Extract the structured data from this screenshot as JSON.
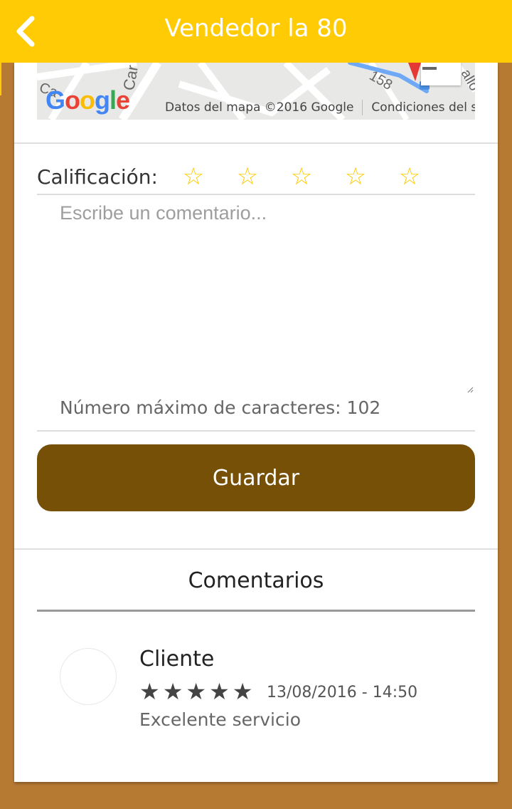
{
  "header": {
    "title": "Vendedor la 80"
  },
  "map": {
    "attribution": "Datos del mapa ©2016 Google",
    "terms": "Condiciones del servicio",
    "logo_letters": [
      "G",
      "o",
      "o",
      "g",
      "l",
      "e"
    ],
    "street_labels": [
      "Car",
      "158",
      "Ca",
      "allo"
    ]
  },
  "rating": {
    "label": "Calificación:",
    "stars": [
      "☆",
      "☆",
      "☆",
      "☆",
      "☆"
    ],
    "star_color": "#FFCB05"
  },
  "comment_form": {
    "placeholder": "Escribe un comentario...",
    "char_limit_text": "Número máximo de caracteres: 102",
    "save_label": "Guardar",
    "save_color": "#765006"
  },
  "comments": {
    "title": "Comentarios",
    "items": [
      {
        "author": "Cliente",
        "stars": "★★★★★",
        "date": "13/08/2016 - 14:50",
        "text": "Excelente servicio"
      }
    ]
  },
  "colors": {
    "header_bg": "#FFCB05",
    "page_bg": "#B77A33"
  }
}
